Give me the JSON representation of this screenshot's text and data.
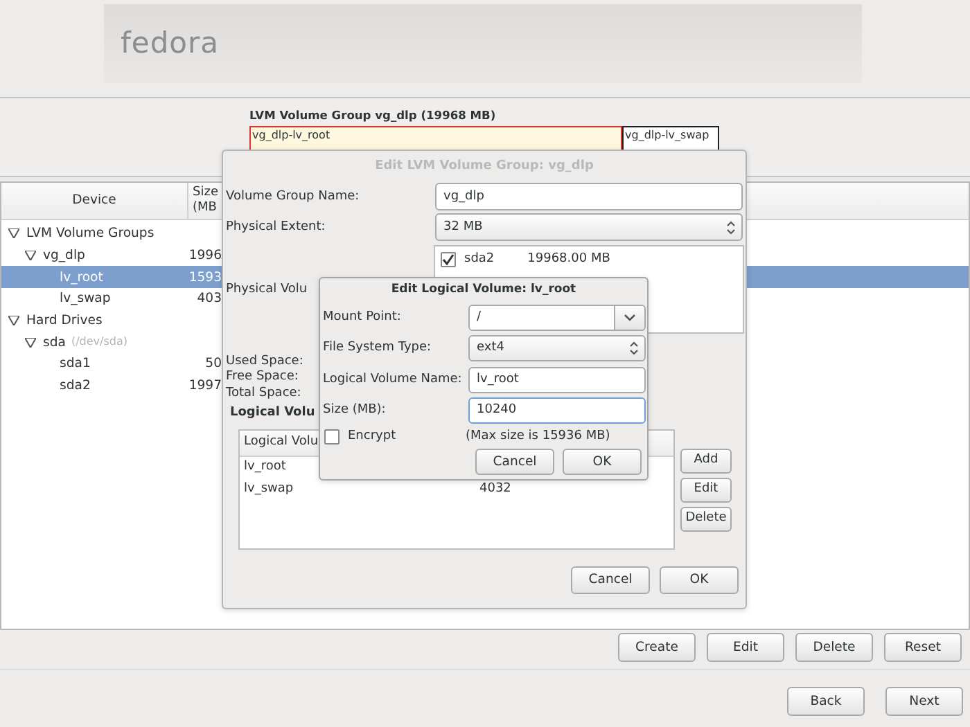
{
  "header": {
    "logo": "fedora"
  },
  "volume_group_panel": {
    "title": "LVM Volume Group vg_dlp (19968 MB)",
    "segments": [
      {
        "label": "vg_dlp-lv_root",
        "selected": true
      },
      {
        "label": "vg_dlp-lv_swap",
        "selected": false
      }
    ]
  },
  "device_table": {
    "columns": [
      "Device",
      "Size (MB"
    ],
    "rows": [
      {
        "device": "LVM Volume Groups",
        "expanded": true,
        "selected": false,
        "children": [
          {
            "device": "vg_dlp",
            "size": "1996",
            "expanded": true,
            "selected": false,
            "children": [
              {
                "device": "lv_root",
                "size": "1593",
                "selected": true
              },
              {
                "device": "lv_swap",
                "size": "403",
                "selected": false
              }
            ]
          }
        ]
      },
      {
        "device": "Hard Drives",
        "expanded": true,
        "selected": false,
        "children": [
          {
            "device": "sda",
            "detail": "(/dev/sda)",
            "expanded": true,
            "selected": false,
            "children": [
              {
                "device": "sda1",
                "size": "50",
                "selected": false
              },
              {
                "device": "sda2",
                "size": "1997",
                "selected": false
              }
            ]
          }
        ]
      }
    ]
  },
  "table_buttons": [
    "Create",
    "Edit",
    "Delete",
    "Reset"
  ],
  "nav_buttons": [
    "Back",
    "Next"
  ],
  "volume_group_dialog": {
    "title": "Edit LVM Volume Group: vg_dlp",
    "fields": [
      {
        "kind": "text",
        "label": "Volume Group Name:",
        "value": "vg_dlp",
        "focused": false
      },
      {
        "kind": "select",
        "label": "Physical Extent:",
        "value": "32 MB",
        "focused": false
      }
    ],
    "physical_volumes": {
      "label": "Physical Volu",
      "items": [
        {
          "name": "sda2",
          "size": "19968.00 MB",
          "checked": true
        }
      ]
    },
    "space_labels": [
      "Used Space:",
      "Free Space:",
      "Total Space:"
    ],
    "logical_volumes": {
      "title": "Logical Volu",
      "column_1": "Logical Volu",
      "rows": [
        {
          "name": "lv_root"
        },
        {
          "name": "lv_swap",
          "size": "4032"
        }
      ],
      "buttons": [
        "Add",
        "Edit",
        "Delete"
      ]
    },
    "buttons": [
      "Cancel",
      "OK"
    ]
  },
  "logical_volume_dialog": {
    "title": "Edit Logical Volume: lv_root",
    "fields": [
      {
        "kind": "combo-entry",
        "label": "Mount Point:",
        "value": "/",
        "focused": false
      },
      {
        "kind": "select",
        "label": "File System Type:",
        "value": "ext4",
        "focused": false
      },
      {
        "kind": "text",
        "label": "Logical Volume Name:",
        "value": "lv_root",
        "focused": false
      },
      {
        "kind": "text",
        "label": "Size (MB):",
        "value": "10240",
        "focused": true
      }
    ],
    "encrypt": {
      "label": "Encrypt",
      "checked": false
    },
    "note": "(Max size is 15936 MB)",
    "buttons": [
      "Cancel",
      "OK"
    ]
  }
}
